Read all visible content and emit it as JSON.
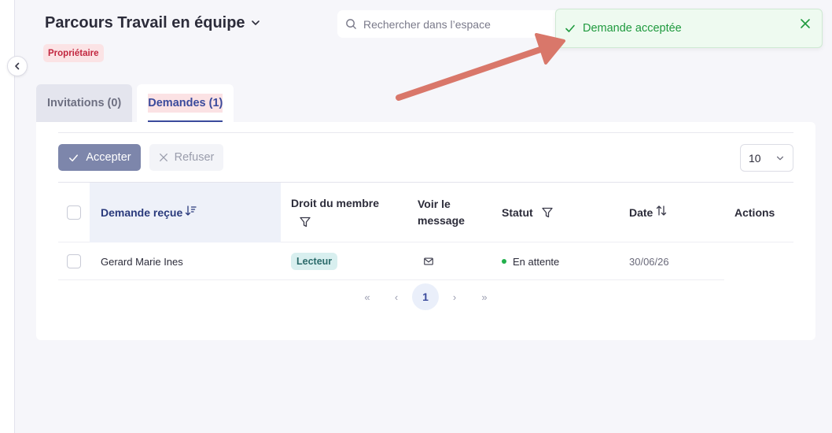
{
  "header": {
    "title": "Parcours Travail en équipe",
    "role_badge": "Propriétaire"
  },
  "search": {
    "placeholder": "Rechercher dans l’espace"
  },
  "toast": {
    "message": "Demande acceptée",
    "color": "#1f9a3e"
  },
  "tabs": [
    {
      "label": "Invitations (0)",
      "active": false
    },
    {
      "label": "Demandes (1)",
      "active": true
    }
  ],
  "toolbar": {
    "accept_label": "Accepter",
    "refuse_label": "Refuser",
    "page_size": "10"
  },
  "table": {
    "columns": [
      {
        "label": "Demande reçue",
        "icon": "sort-descending-icon"
      },
      {
        "label": "Droit du membre",
        "icon": "filter-icon"
      },
      {
        "label": "Voir le message"
      },
      {
        "label": "Statut",
        "icon": "filter-icon"
      },
      {
        "label": "Date",
        "icon": "sort-icon"
      },
      {
        "label": "Actions"
      }
    ],
    "rows": [
      {
        "name": "Gerard Marie Ines",
        "role": "Lecteur",
        "message_icon": "mail-icon",
        "status": "En attente",
        "status_color": "#22b04b",
        "date": "30/06/26"
      }
    ]
  },
  "pagination": {
    "current": "1",
    "first": "«",
    "prev": "‹",
    "next": "›",
    "last": "»"
  },
  "colors": {
    "accent": "#3a4a9c",
    "arrow": "#d9776a"
  }
}
